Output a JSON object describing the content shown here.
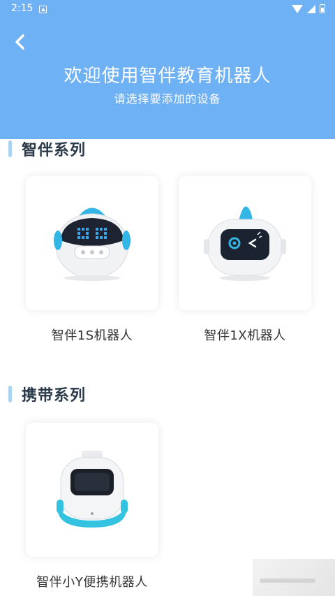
{
  "status_bar": {
    "time": "2:15"
  },
  "header": {
    "title": "欢迎使用智伴教育机器人",
    "subtitle": "请选择要添加的设备"
  },
  "sections": [
    {
      "title": "智伴系列",
      "devices": [
        {
          "label": "智伴1S机器人"
        },
        {
          "label": "智伴1X机器人"
        }
      ]
    },
    {
      "title": "携带系列",
      "devices": [
        {
          "label": "智伴小Y便携机器人"
        }
      ]
    }
  ],
  "colors": {
    "header_bg": "#6fb1f5",
    "accent_bar": "#a9d3f3",
    "robot_cyan": "#33b6e6",
    "text_dark": "#2b3a4a"
  }
}
